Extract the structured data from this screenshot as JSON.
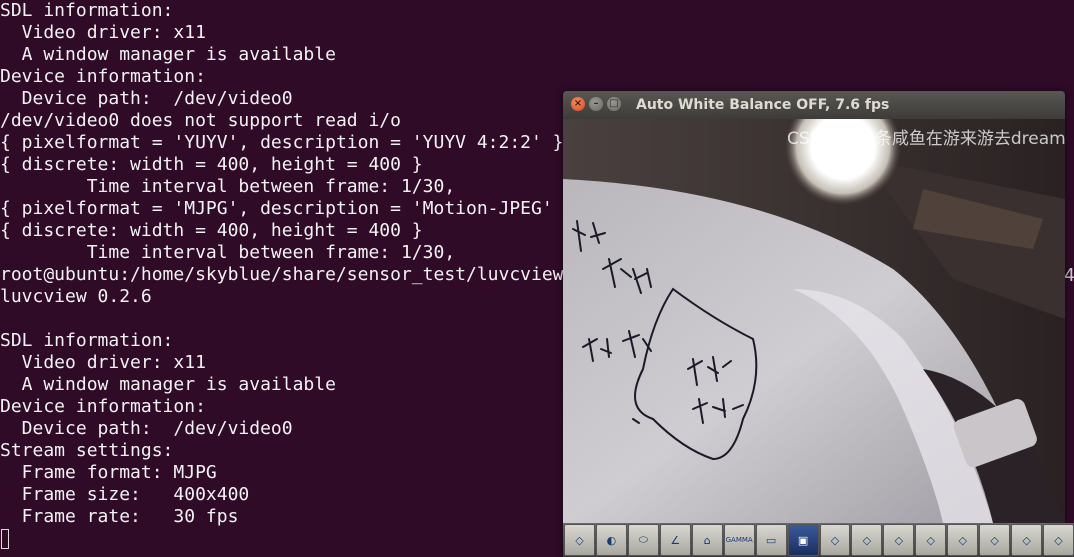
{
  "terminal": {
    "lines": [
      "SDL information:",
      "  Video driver: x11",
      "  A window manager is available",
      "Device information:",
      "  Device path:  /dev/video0",
      "/dev/video0 does not support read i/o",
      "{ pixelformat = 'YUYV', description = 'YUYV 4:2:2' }",
      "{ discrete: width = 400, height = 400 }",
      "        Time interval between frame: 1/30,",
      "{ pixelformat = 'MJPG', description = 'Motion-JPEG' }",
      "{ discrete: width = 400, height = 400 }",
      "        Time interval between frame: 1/30,",
      "root@ubuntu:/home/skyblue/share/sensor_test/luvcview",
      "luvcview 0.2.6",
      "",
      "SDL information:",
      "  Video driver: x11",
      "  A window manager is available",
      "Device information:",
      "  Device path:  /dev/video0",
      "Stream settings:",
      "  Frame format: MJPG",
      "  Frame size:   400x400",
      "  Frame rate:   30 fps"
    ],
    "edge_char": "4"
  },
  "window": {
    "title": "Auto White Balance OFF, 7.6 fps",
    "close_glyph": "×",
    "minimize_glyph": "–",
    "maximize_glyph": "□"
  },
  "toolbar": {
    "buttons": [
      {
        "icon": "brightness-icon",
        "glyph": "◇"
      },
      {
        "icon": "contrast-icon",
        "glyph": "◐"
      },
      {
        "icon": "saturation-icon",
        "glyph": "⬭"
      },
      {
        "icon": "gain-icon",
        "glyph": "∠"
      },
      {
        "icon": "sharpness-icon",
        "glyph": "⌂"
      },
      {
        "icon": "gamma-icon",
        "glyph": "GAMMA"
      },
      {
        "icon": "record-icon",
        "glyph": "▭"
      },
      {
        "icon": "snapshot-icon",
        "glyph": "▣",
        "active": true
      },
      {
        "icon": "white-balance-icon",
        "glyph": "◇"
      },
      {
        "icon": "exposure-icon",
        "glyph": "◇"
      },
      {
        "icon": "focus-icon",
        "glyph": "◇"
      },
      {
        "icon": "pan-icon",
        "glyph": "◇"
      },
      {
        "icon": "tilt-icon",
        "glyph": "◇"
      },
      {
        "icon": "zoom-icon",
        "glyph": "◇"
      },
      {
        "icon": "reset-icon",
        "glyph": "◇"
      },
      {
        "icon": "quit-icon",
        "glyph": "◇"
      }
    ]
  },
  "watermark": "CSDN @一条咸鱼在游来游去dreams"
}
